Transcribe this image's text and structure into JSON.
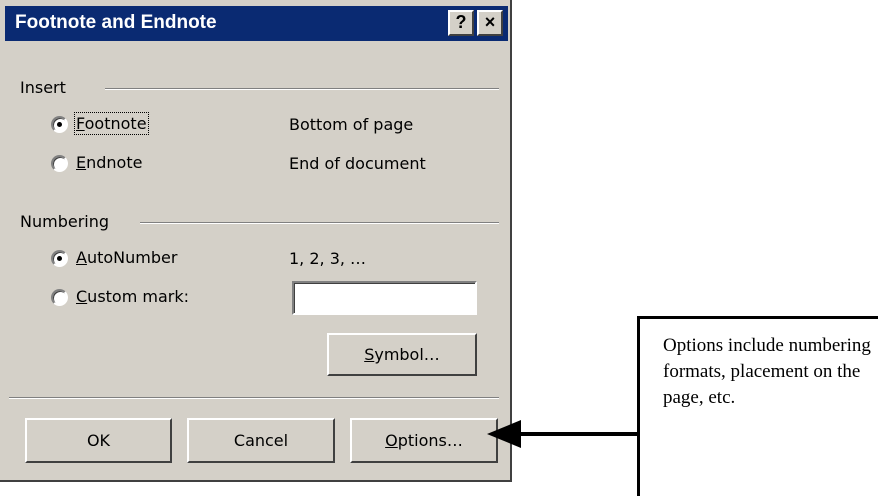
{
  "window": {
    "title": "Footnote and Endnote",
    "help_label": "?",
    "close_label": "×"
  },
  "insert": {
    "title": "Insert",
    "options": [
      {
        "mnemonic": "F",
        "rest": "ootnote",
        "value": "Bottom of page",
        "checked": true
      },
      {
        "mnemonic": "E",
        "rest": "ndnote",
        "value": "End of document",
        "checked": false
      }
    ]
  },
  "numbering": {
    "title": "Numbering",
    "auto": {
      "mnemonic": "A",
      "rest": "utoNumber",
      "value": "1, 2, 3, …",
      "checked": true
    },
    "custom": {
      "mnemonic": "C",
      "rest": "ustom mark:",
      "checked": false,
      "input_value": ""
    }
  },
  "buttons": {
    "symbol": {
      "mnemonic": "S",
      "rest": "ymbol…"
    },
    "ok": "OK",
    "cancel": "Cancel",
    "options": {
      "mnemonic": "O",
      "rest": "ptions…"
    }
  },
  "callout": {
    "text": "Options include numbering formats, placement on the page, etc."
  }
}
